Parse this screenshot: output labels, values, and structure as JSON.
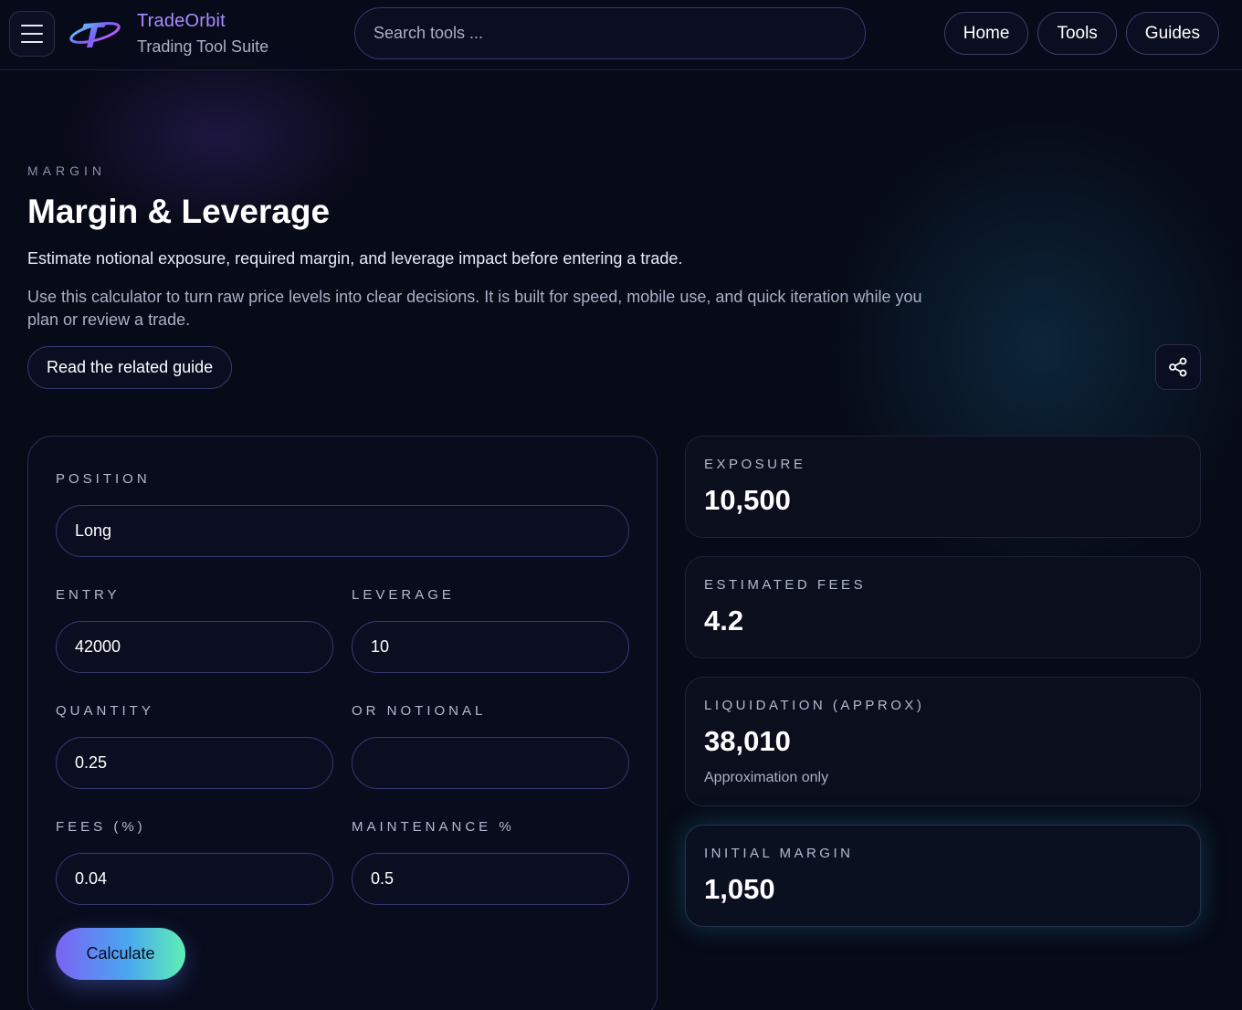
{
  "header": {
    "brand_name": "TradeOrbit",
    "brand_subtitle": "Trading Tool Suite",
    "search_placeholder": "Search tools ...",
    "nav": [
      "Home",
      "Tools",
      "Guides"
    ]
  },
  "hero": {
    "eyebrow": "MARGIN",
    "title": "Margin & Leverage",
    "lead": "Estimate notional exposure, required margin, and leverage impact before entering a trade.",
    "description": "Use this calculator to turn raw price levels into clear decisions. It is built for speed, mobile use, and quick iteration while you plan or review a trade.",
    "guide_button": "Read the related guide"
  },
  "form": {
    "position_label": "POSITION",
    "position_value": "Long",
    "entry_label": "ENTRY",
    "entry_value": "42000",
    "leverage_label": "LEVERAGE",
    "leverage_value": "10",
    "quantity_label": "QUANTITY",
    "quantity_value": "0.25",
    "notional_label": "OR NOTIONAL",
    "notional_value": "",
    "fees_label": "FEES (%)",
    "fees_value": "0.04",
    "maintenance_label": "MAINTENANCE %",
    "maintenance_value": "0.5",
    "calculate_button": "Calculate"
  },
  "results": [
    {
      "label": "EXPOSURE",
      "value": "10,500"
    },
    {
      "label": "ESTIMATED FEES",
      "value": "4.2"
    },
    {
      "label": "LIQUIDATION (APPROX)",
      "value": "38,010",
      "note": "Approximation only"
    },
    {
      "label": "INITIAL MARGIN",
      "value": "1,050"
    }
  ],
  "colors": {
    "background": "#070a17",
    "brand": "#a98cff",
    "accent_gradient_start": "#7b63f5",
    "accent_gradient_end": "#5ef0b6"
  },
  "icons": {
    "menu": "hamburger-icon",
    "logo": "planet-logo-icon",
    "share": "share-icon"
  }
}
